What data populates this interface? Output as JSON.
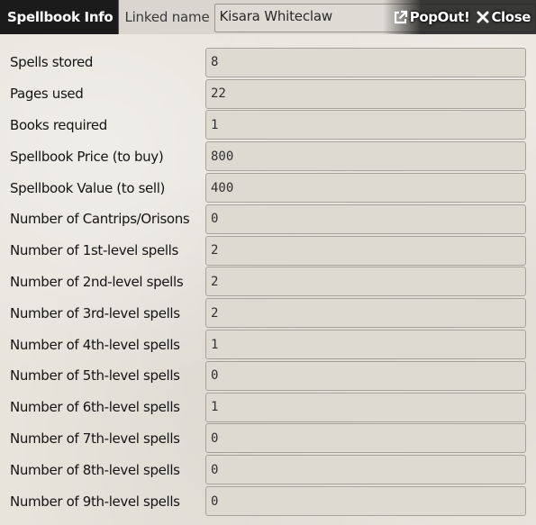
{
  "header": {
    "title": "Spellbook Info",
    "linked_label": "Linked name",
    "linked_value": "Kisara Whiteclaw",
    "popout_label": "PopOut!",
    "close_label": "Close"
  },
  "rows": [
    {
      "label": "Spells stored",
      "value": "8"
    },
    {
      "label": "Pages used",
      "value": "22"
    },
    {
      "label": "Books required",
      "value": "1"
    },
    {
      "label": "Spellbook Price (to buy)",
      "value": "800"
    },
    {
      "label": "Spellbook Value (to sell)",
      "value": "400"
    },
    {
      "label": "Number of Cantrips/Orisons",
      "value": "0"
    },
    {
      "label": "Number of 1st-level spells",
      "value": "2"
    },
    {
      "label": "Number of 2nd-level spells",
      "value": "2"
    },
    {
      "label": "Number of 3rd-level spells",
      "value": "2"
    },
    {
      "label": "Number of 4th-level spells",
      "value": "1"
    },
    {
      "label": "Number of 5th-level spells",
      "value": "0"
    },
    {
      "label": "Number of 6th-level spells",
      "value": "1"
    },
    {
      "label": "Number of 7th-level spells",
      "value": "0"
    },
    {
      "label": "Number of 8th-level spells",
      "value": "0"
    },
    {
      "label": "Number of 9th-level spells",
      "value": "0"
    }
  ],
  "icons": {
    "popout": "external-link-icon",
    "close": "close-x-icon"
  },
  "colors": {
    "header_bg": "#1b1b1b",
    "parchment_bg": "#e7e4dc",
    "field_bg": "#dddad2",
    "field_border": "#a8a49b"
  }
}
